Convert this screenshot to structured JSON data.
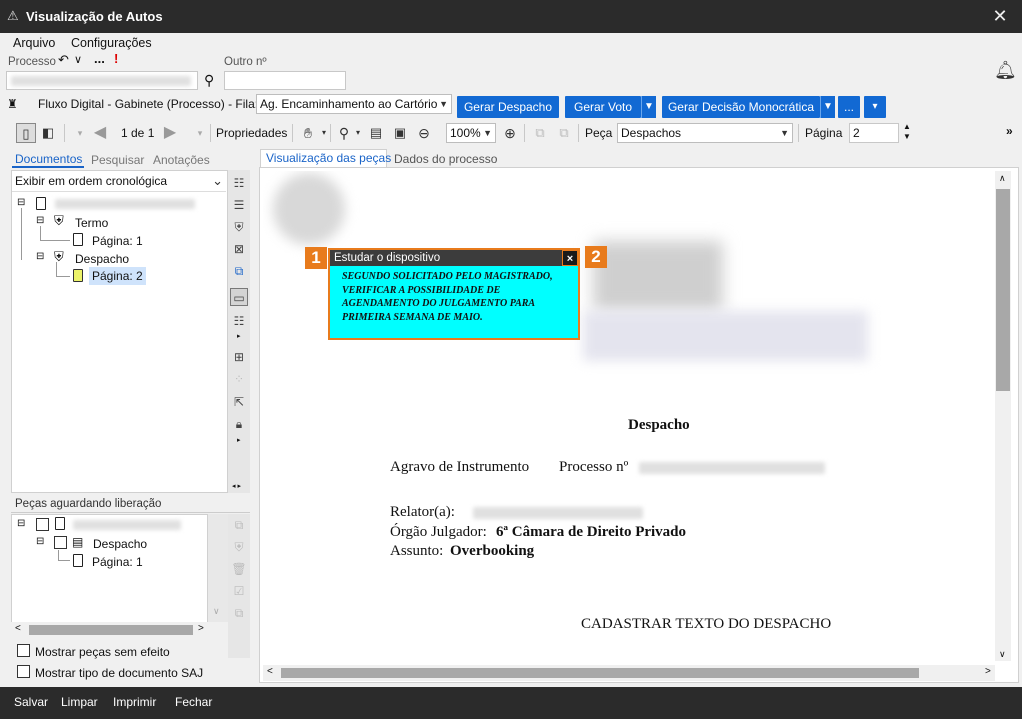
{
  "window": {
    "title": "Visualização de Autos"
  },
  "menu": {
    "arquivo": "Arquivo",
    "configuracoes": "Configurações"
  },
  "processo": {
    "label": "Processo",
    "outro_label": "Outro nº",
    "more": "...",
    "alert": "!"
  },
  "fluxo": {
    "label": "Fluxo Digital - Gabinete (Processo) - Fila:",
    "fila_value": "Ag. Encaminhamento ao Cartório",
    "buttons": {
      "despacho": "Gerar Despacho",
      "voto": "Gerar Voto",
      "decisao": "Gerar Decisão Monocrática",
      "more": "..."
    }
  },
  "toolbar": {
    "page_counter": "1 de 1",
    "propriedades": "Propriedades",
    "zoom": "100%",
    "peca_label": "Peça",
    "peca_value": "Despachos",
    "pagina_label": "Página",
    "pagina_value": "2"
  },
  "left_tabs": [
    "Documentos",
    "Pesquisar",
    "Anotações"
  ],
  "order_select": "Exibir em ordem cronológica",
  "tree": {
    "termo": "Termo",
    "termo_page": "Página: 1",
    "despacho": "Despacho",
    "despacho_page": "Página: 2"
  },
  "pending": {
    "title": "Peças aguardando liberação",
    "despacho": "Despacho",
    "page": "Página: 1"
  },
  "checks": {
    "sem_efeito": "Mostrar peças sem efeito",
    "tipo_saj": "Mostrar tipo de documento SAJ"
  },
  "view_tabs": {
    "pecas": "Visualização das peças",
    "dados": "Dados do processo"
  },
  "document": {
    "heading": "Despacho",
    "agravo": "Agravo de Instrumento",
    "processo_label": "Processo nº",
    "relator_label": "Relator(a):",
    "orgao_label": "Órgão Julgador:",
    "orgao_value": "6ª Câmara de Direito Privado",
    "assunto_label": "Assunto:",
    "assunto_value": "Overbooking",
    "cadastrar": "CADASTRAR TEXTO DO DESPACHO"
  },
  "note": {
    "title": "Estudar o dispositivo",
    "close": "×",
    "text": "SEGUNDO SOLICITADO PELO MAGISTRADO, VERIFICAR A POSSIBILIDADE DE AGENDAMENTO DO JULGAMENTO PARA PRIMEIRA SEMANA DE MAIO.",
    "badge1": "1",
    "badge2": "2"
  },
  "bottom": {
    "salvar": "Salvar",
    "limpar": "Limpar",
    "imprimir": "Imprimir",
    "fechar": "Fechar"
  },
  "colors": {
    "accent": "#1269d3",
    "note_bg": "#00ffff",
    "note_border": "#e87b1c",
    "titlebar": "#2b2b2b"
  }
}
